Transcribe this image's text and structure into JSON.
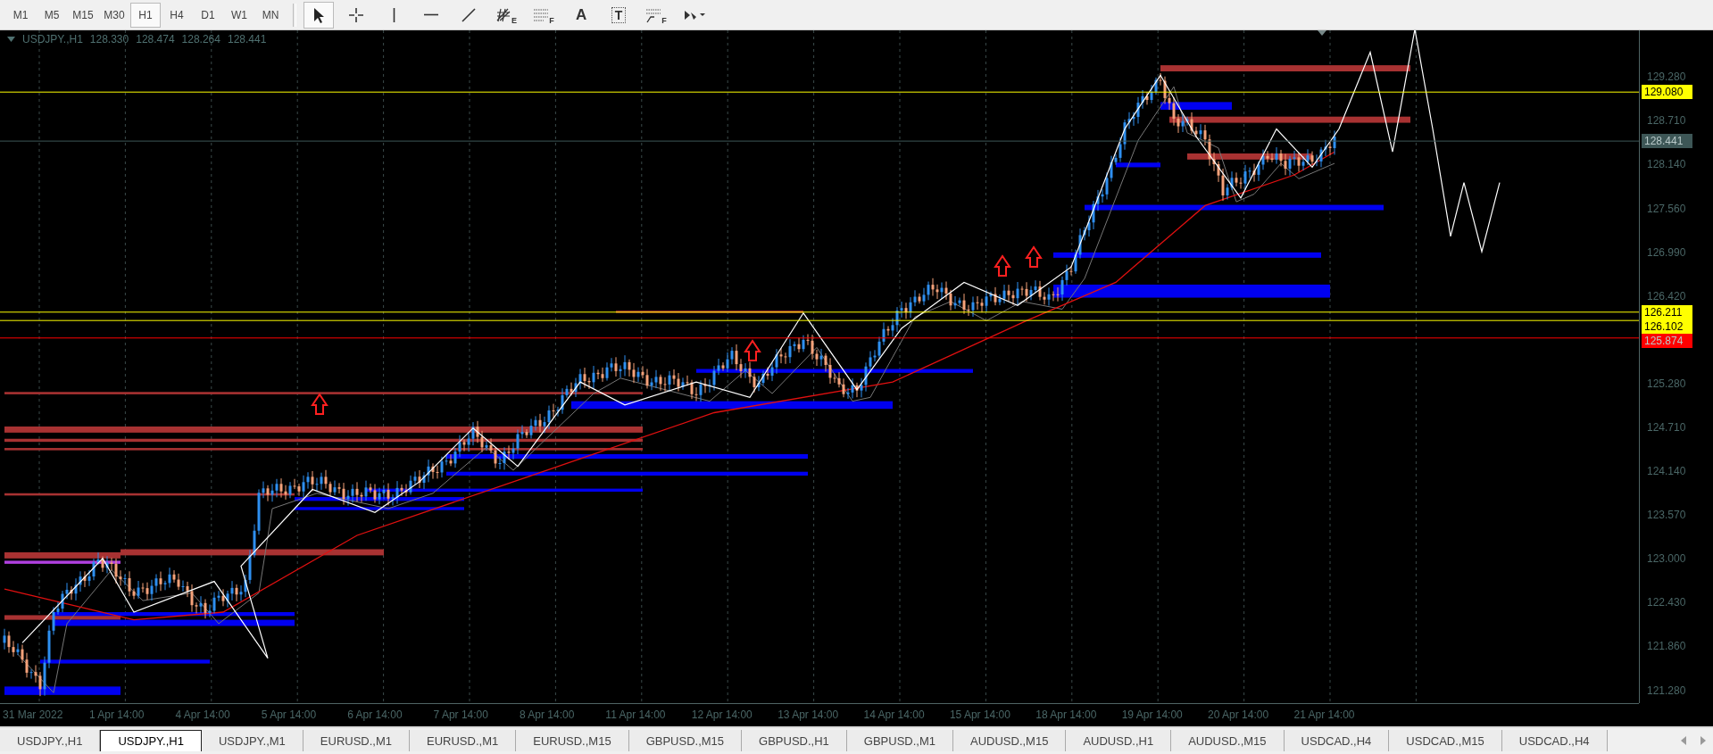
{
  "toolbar": {
    "timeframes": [
      {
        "label": "M1",
        "selected": false
      },
      {
        "label": "M5",
        "selected": false
      },
      {
        "label": "M15",
        "selected": false
      },
      {
        "label": "M30",
        "selected": false
      },
      {
        "label": "H1",
        "selected": true
      },
      {
        "label": "H4",
        "selected": false
      },
      {
        "label": "D1",
        "selected": false
      },
      {
        "label": "W1",
        "selected": false
      },
      {
        "label": "MN",
        "selected": false
      }
    ],
    "tools": [
      {
        "kind": "cursor",
        "selected": true
      },
      {
        "kind": "crosshair",
        "selected": false
      },
      {
        "kind": "vline",
        "selected": false
      },
      {
        "kind": "hline",
        "selected": false
      },
      {
        "kind": "trendline",
        "selected": false
      },
      {
        "kind": "fan",
        "label": "E",
        "selected": false
      },
      {
        "kind": "levels",
        "label": "F",
        "selected": false
      },
      {
        "kind": "text",
        "label": "A",
        "selected": false
      },
      {
        "kind": "boxtext",
        "label": "T",
        "selected": false
      },
      {
        "kind": "expansion",
        "label": "F",
        "selected": false
      },
      {
        "kind": "arrows",
        "selected": false
      }
    ]
  },
  "chart": {
    "symbol": "USDJPY.,H1",
    "ohlc": [
      "128.330",
      "128.474",
      "128.264",
      "128.441"
    ],
    "price_axis": [
      "129.280",
      "128.710",
      "128.140",
      "127.560",
      "126.990",
      "126.420",
      "125.280",
      "124.710",
      "124.140",
      "123.570",
      "123.000",
      "122.430",
      "121.860",
      "121.280"
    ],
    "price_tags": [
      {
        "price": "129.080",
        "color": "#ffff00"
      },
      {
        "price": "128.441",
        "color": "#3d5656"
      },
      {
        "price": "126.211",
        "color": "#ffff00"
      },
      {
        "price": "126.102",
        "color": "#ffff00"
      },
      {
        "price": "125.874",
        "color": "#ff0000"
      }
    ],
    "time_axis": [
      "31 Mar 2022",
      "1 Apr 14:00",
      "4 Apr 14:00",
      "5 Apr 14:00",
      "6 Apr 14:00",
      "7 Apr 14:00",
      "8 Apr 14:00",
      "11 Apr 14:00",
      "12 Apr 14:00",
      "13 Apr 14:00",
      "14 Apr 14:00",
      "15 Apr 14:00",
      "18 Apr 14:00",
      "19 Apr 14:00",
      "20 Apr 14:00",
      "21 Apr 14:00"
    ]
  },
  "tabs": [
    {
      "label": "USDJPY.,H1",
      "selected": false
    },
    {
      "label": "USDJPY.,H1",
      "selected": true
    },
    {
      "label": "USDJPY.,M1",
      "selected": false
    },
    {
      "label": "EURUSD.,M1",
      "selected": false
    },
    {
      "label": "EURUSD.,M1",
      "selected": false
    },
    {
      "label": "EURUSD.,M15",
      "selected": false
    },
    {
      "label": "GBPUSD.,M15",
      "selected": false
    },
    {
      "label": "GBPUSD.,H1",
      "selected": false
    },
    {
      "label": "GBPUSD.,M1",
      "selected": false
    },
    {
      "label": "AUDUSD.,M15",
      "selected": false
    },
    {
      "label": "AUDUSD.,H1",
      "selected": false
    },
    {
      "label": "AUDUSD.,M15",
      "selected": false
    },
    {
      "label": "USDCAD.,H4",
      "selected": false
    },
    {
      "label": "USDCAD.,M15",
      "selected": false
    },
    {
      "label": "USDCAD.,H4",
      "selected": false
    }
  ]
}
